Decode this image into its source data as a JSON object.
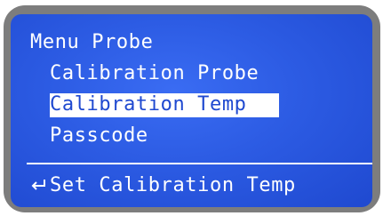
{
  "screen": {
    "title": "Menu Probe",
    "items": [
      {
        "label": "Calibration Probe",
        "selected": false
      },
      {
        "label": "Calibration Temp",
        "selected": true
      },
      {
        "label": "Passcode",
        "selected": false
      }
    ],
    "footer": {
      "icon": "enter-arrow-icon",
      "hint": "Set Calibration Temp"
    }
  },
  "colors": {
    "screen_bg": "#2c5be3",
    "text": "#ffffff",
    "highlight_bg": "#ffffff",
    "highlight_text": "#1f49d0",
    "bezel": "#7d7d7d"
  }
}
